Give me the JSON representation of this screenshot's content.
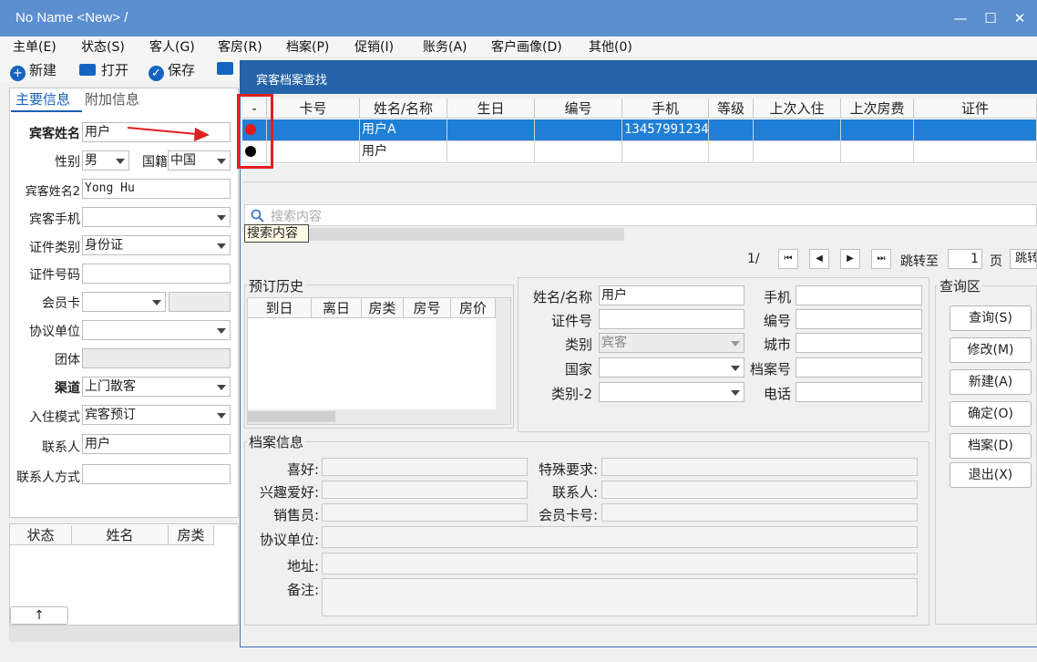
{
  "window": {
    "title": "No Name <New> /",
    "minimize": "—",
    "maximize": "☐",
    "close": "✕"
  },
  "menu": [
    "主单(E)",
    "状态(S)",
    "客人(G)",
    "客房(R)",
    "档案(P)",
    "促销(I)",
    "账务(A)",
    "客户画像(D)",
    "其他(0)"
  ],
  "toolbar": {
    "new": "新建",
    "open": "打开",
    "save": "保存"
  },
  "left": {
    "tabs": [
      "主要信息",
      "附加信息"
    ],
    "fields": {
      "guest_name_label": "宾客姓名",
      "guest_name": "用户",
      "gender_label": "性别",
      "gender": "男",
      "nation_label": "国籍",
      "nation": "中国",
      "guest_name2_label": "宾客姓名2",
      "guest_name2": "Yong Hu",
      "mobile_label": "宾客手机",
      "mobile": "",
      "id_type_label": "证件类别",
      "id_type": "身份证",
      "id_no_label": "证件号码",
      "id_no": "",
      "member_label": "会员卡",
      "member": "",
      "agreement_label": "协议单位",
      "agreement": "",
      "group_label": "团体",
      "group": "",
      "channel_label": "渠道",
      "channel": "上门散客",
      "checkin_label": "入住模式",
      "checkin": "宾客预订",
      "contact_label": "联系人",
      "contact": "用户",
      "contact_way_label": "联系人方式",
      "contact_way": ""
    },
    "list_headers": [
      "状态",
      "姓名",
      "房类"
    ],
    "up_arrow": "↑"
  },
  "dialog": {
    "title": "宾客档案查找",
    "columns": [
      "-",
      "卡号",
      "姓名/名称",
      "生日",
      "编号",
      "手机",
      "等级",
      "上次入住",
      "上次房费",
      "证件"
    ],
    "rows": [
      {
        "dot": "#e81818",
        "card": "",
        "name": "用户A",
        "birthday": "",
        "no": "",
        "mobile": "13457991234"
      },
      {
        "dot": "#000000",
        "card": "",
        "name": "用户",
        "birthday": "",
        "no": "",
        "mobile": ""
      }
    ],
    "search_placeholder": "搜索内容",
    "search_tooltip": "搜索内容",
    "pager": {
      "page": "1/",
      "first": "⏮",
      "prev": "◀",
      "next": "▶",
      "last": "⏭",
      "goto_label": "跳转至",
      "goto_value": "1",
      "page_unit": "页",
      "jump": "跳转"
    },
    "history": {
      "title": "预订历史",
      "headers": [
        "到日",
        "离日",
        "房类",
        "房号",
        "房价"
      ]
    },
    "query": {
      "name_label": "姓名/名称",
      "name": "用户",
      "mobile_label": "手机",
      "mobile": "",
      "id_label": "证件号",
      "id": "",
      "no_label": "编号",
      "no": "",
      "type_label": "类别",
      "type": "宾客",
      "city_label": "城市",
      "city": "",
      "country_label": "国家",
      "country": "",
      "archive_label": "档案号",
      "archive": "",
      "type2_label": "类别-2",
      "type2": "",
      "phone_label": "电话",
      "phone": ""
    },
    "archive": {
      "title": "档案信息",
      "hobby": "喜好:",
      "special": "特殊要求:",
      "interest": "兴趣爱好:",
      "contact": "联系人:",
      "sales": "销售员:",
      "member_card": "会员卡号:",
      "agreement": "协议单位:",
      "address": "地址:",
      "remark": "备注:"
    },
    "query_area": {
      "title": "查询区",
      "buttons": [
        "查询(S)",
        "修改(M)",
        "新建(A)",
        "确定(O)",
        "档案(D)",
        "退出(X)"
      ]
    }
  }
}
